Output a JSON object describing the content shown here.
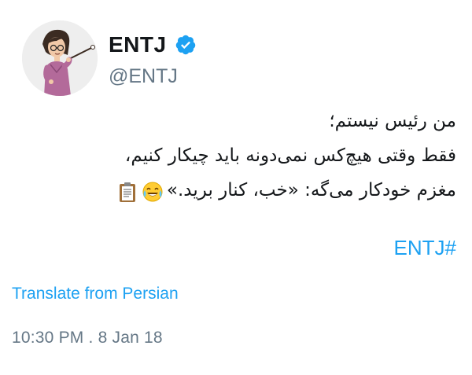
{
  "author": {
    "display_name": "ENTJ",
    "handle": "@ENTJ",
    "verified": true,
    "avatar_icon": "avatar-presenter-woman"
  },
  "tweet": {
    "lines": [
      "من رئیس نیستم؛",
      "فقط وقتی هیچ‌کس نمی‌دونه باید چیکار کنیم،",
      "مغزم خودکار می‌گه: «خب، کنار برید.»"
    ],
    "emojis": [
      "face-with-tears-of-joy-icon",
      "clipboard-icon"
    ],
    "hashtag": "ENTJ#"
  },
  "translate_label": "Translate from Persian",
  "timestamp": "10:30 PM . 8 Jan 18",
  "colors": {
    "link": "#1da1f2",
    "muted": "#657786",
    "text": "#14171a"
  }
}
